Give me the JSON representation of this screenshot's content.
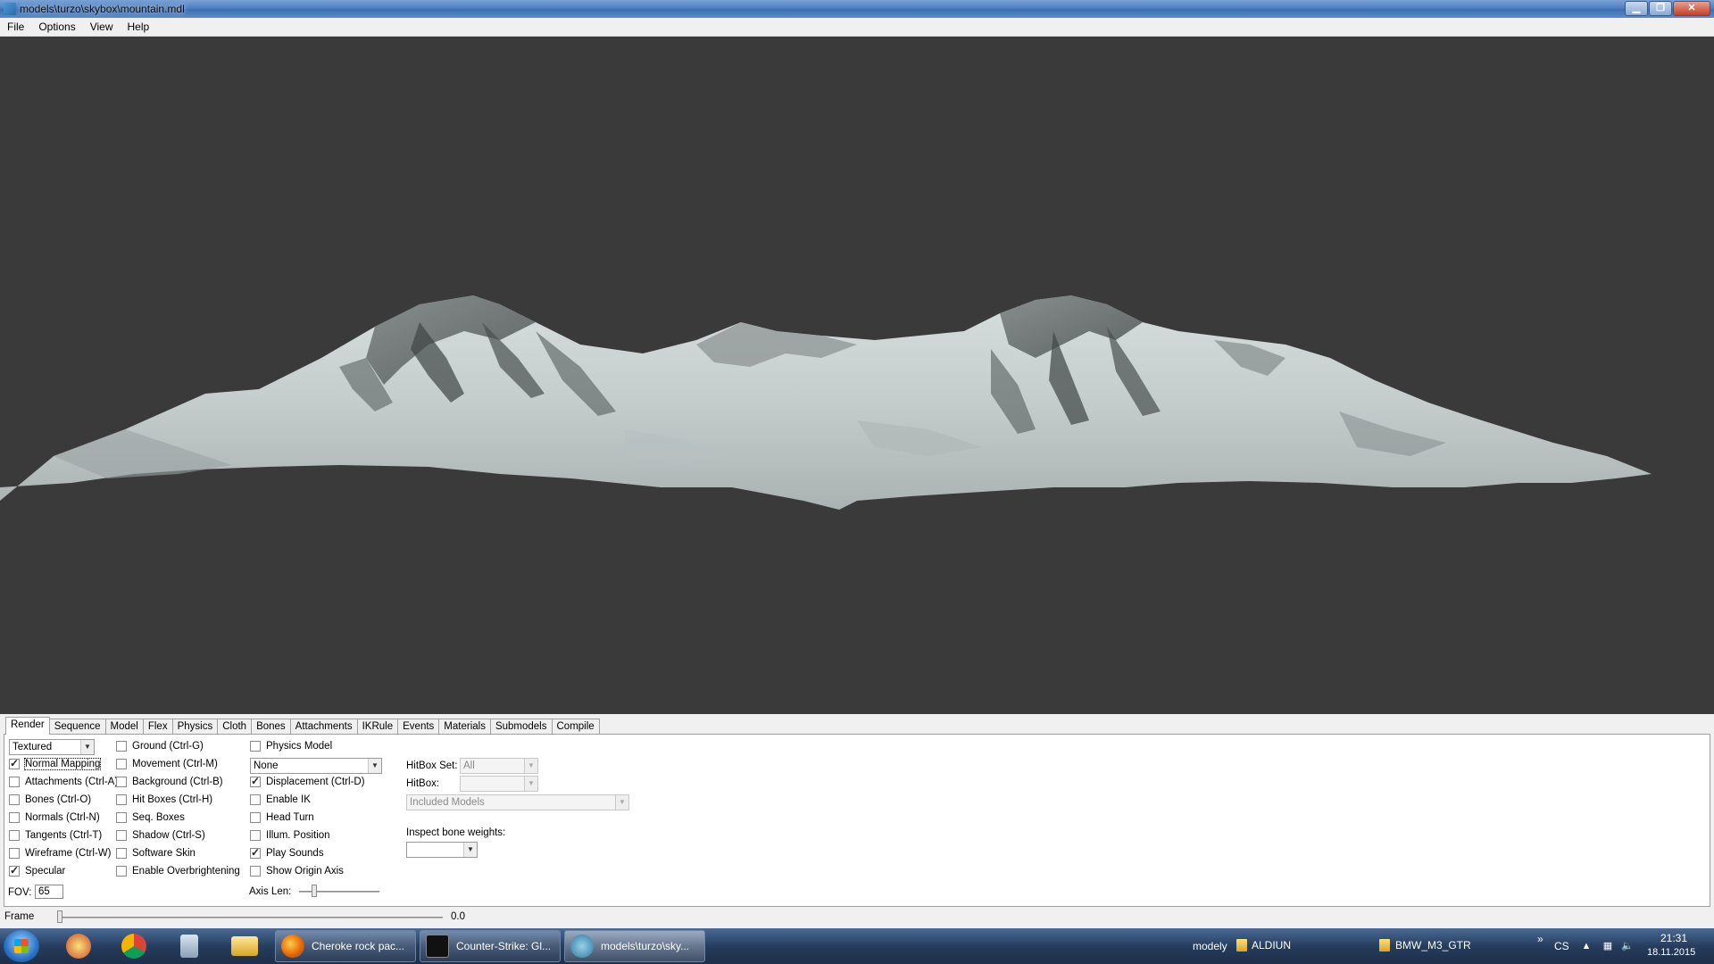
{
  "window": {
    "title": "models\\turzo\\skybox\\mountain.mdl",
    "buttons": {
      "minimize": "▁",
      "maximize": "❐",
      "close": "✕"
    }
  },
  "menu": [
    "File",
    "Options",
    "View",
    "Help"
  ],
  "tabs": [
    "Render",
    "Sequence",
    "Model",
    "Flex",
    "Physics",
    "Cloth",
    "Bones",
    "Attachments",
    "IKRule",
    "Events",
    "Materials",
    "Submodels",
    "Compile"
  ],
  "render": {
    "render_mode": "Textured",
    "col1": [
      {
        "label": "Normal Mapping",
        "checked": true
      },
      {
        "label": "Attachments (Ctrl-A)",
        "checked": false
      },
      {
        "label": "Bones (Ctrl-O)",
        "checked": false
      },
      {
        "label": "Normals (Ctrl-N)",
        "checked": false
      },
      {
        "label": "Tangents (Ctrl-T)",
        "checked": false
      },
      {
        "label": "Wireframe (Ctrl-W)",
        "checked": false
      },
      {
        "label": "Specular",
        "checked": true
      }
    ],
    "fov_label": "FOV:",
    "fov_value": "65",
    "col2": [
      {
        "label": "Ground (Ctrl-G)",
        "checked": false
      },
      {
        "label": "Movement (Ctrl-M)",
        "checked": false
      },
      {
        "label": "Background (Ctrl-B)",
        "checked": false
      },
      {
        "label": "Hit Boxes (Ctrl-H)",
        "checked": false
      },
      {
        "label": "Seq. Boxes",
        "checked": false
      },
      {
        "label": "Shadow (Ctrl-S)",
        "checked": false
      },
      {
        "label": "Software Skin",
        "checked": false
      },
      {
        "label": "Enable Overbrightening",
        "checked": false
      }
    ],
    "physics_model": {
      "label": "Physics Model",
      "checked": false
    },
    "physics_combo": "None",
    "col3": [
      {
        "label": "Displacement (Ctrl-D)",
        "checked": true
      },
      {
        "label": "Enable IK",
        "checked": false
      },
      {
        "label": "Head Turn",
        "checked": false
      },
      {
        "label": "Illum. Position",
        "checked": false
      },
      {
        "label": "Play Sounds",
        "checked": true
      },
      {
        "label": "Show Origin Axis",
        "checked": false
      }
    ],
    "axis_len_label": "Axis Len:",
    "hitbox_set_label": "HitBox Set:",
    "hitbox_set_value": "All",
    "hitbox_label": "HitBox:",
    "hitbox_value": "",
    "included_models": "Included Models",
    "inspect_bone_weights_label": "Inspect bone weights:",
    "inspect_bone_weights_value": ""
  },
  "frame": {
    "label": "Frame",
    "value": "0.0",
    "position": 0.0
  },
  "taskbar": {
    "pinned": [
      "paint-icon",
      "chrome-icon",
      "calculator-icon",
      "explorer-icon"
    ],
    "tasks": [
      {
        "label": "Cheroke rock pac...",
        "icon": "firefox-icon",
        "active": false
      },
      {
        "label": "Counter-Strike: Gl...",
        "icon": "steam-icon",
        "active": false
      },
      {
        "label": "models\\turzo\\sky...",
        "icon": "hlmv-icon",
        "active": true
      }
    ],
    "toolbar_label": "modely",
    "folders": [
      "ALDIUN",
      "BMW_M3_GTR"
    ],
    "overflow": "»",
    "language": "CS",
    "time": "21:31",
    "date": "18.11.2015"
  }
}
